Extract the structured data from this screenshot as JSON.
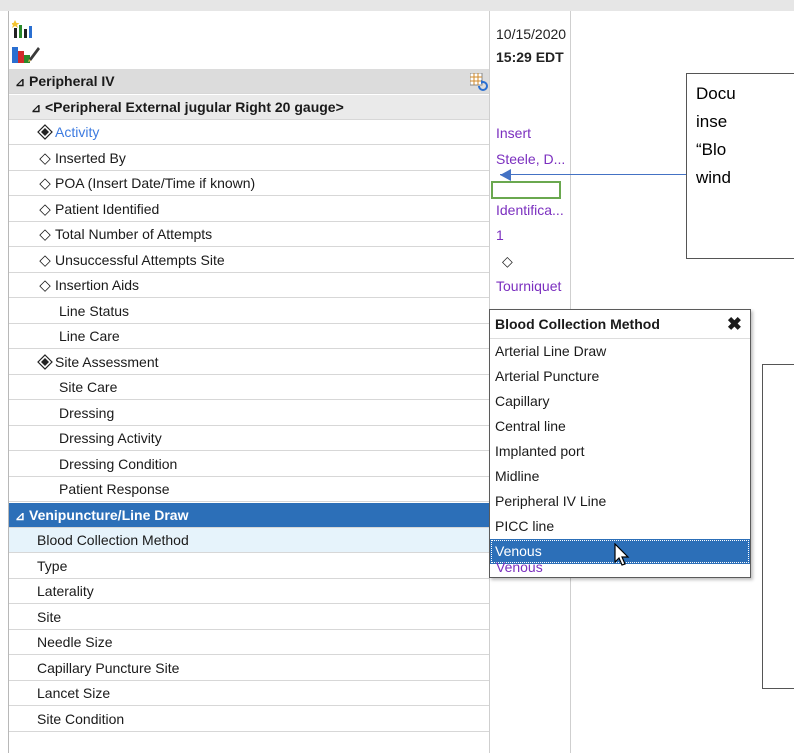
{
  "header": {
    "date": "10/15/2020",
    "time": "15:29 EDT"
  },
  "rows": [
    {
      "label": "Peripheral IV",
      "kind": "sect",
      "marker": "tri",
      "value": ""
    },
    {
      "label": "<Peripheral External jugular Right 20 gauge>",
      "kind": "sub",
      "marker": "tri",
      "value": ""
    },
    {
      "label": "Activity",
      "kind": "item",
      "marker": "dia-star",
      "blue": true,
      "value": "Insert"
    },
    {
      "label": "Inserted By",
      "kind": "item",
      "marker": "dia",
      "value": "Steele, D..."
    },
    {
      "label": "POA (Insert Date/Time if known)",
      "kind": "item",
      "marker": "dia",
      "value": ""
    },
    {
      "label": "Patient Identified",
      "kind": "item",
      "marker": "dia",
      "value": "Identifica..."
    },
    {
      "label": "Total Number of Attempts",
      "kind": "item",
      "marker": "dia",
      "value": "1"
    },
    {
      "label": "Unsuccessful Attempts Site",
      "kind": "item",
      "marker": "dia",
      "value": "◇"
    },
    {
      "label": "Insertion Aids",
      "kind": "item",
      "marker": "dia",
      "value": "Tourniquet"
    },
    {
      "label": "Line Status",
      "kind": "item",
      "marker": "none",
      "value": ""
    },
    {
      "label": "Line Care",
      "kind": "item",
      "marker": "none",
      "value": ""
    },
    {
      "label": "Site Assessment",
      "kind": "item",
      "marker": "dia-star",
      "value": ""
    },
    {
      "label": "Site Care",
      "kind": "item",
      "marker": "none",
      "value": ""
    },
    {
      "label": "Dressing",
      "kind": "item",
      "marker": "none",
      "value": ""
    },
    {
      "label": "Dressing Activity",
      "kind": "item",
      "marker": "none",
      "value": ""
    },
    {
      "label": "Dressing Condition",
      "kind": "item",
      "marker": "none",
      "value": ""
    },
    {
      "label": "Patient Response",
      "kind": "item",
      "marker": "none",
      "value": ""
    },
    {
      "label": "Venipuncture/Line Draw",
      "kind": "sel",
      "marker": "tri",
      "value": ""
    },
    {
      "label": "Blood Collection Method",
      "kind": "hl",
      "marker": "flat",
      "value": ""
    },
    {
      "label": "Type",
      "kind": "item",
      "marker": "flat",
      "value": "Venous"
    },
    {
      "label": "Laterality",
      "kind": "item",
      "marker": "flat",
      "value": ""
    },
    {
      "label": "Site",
      "kind": "item",
      "marker": "flat",
      "value": ""
    },
    {
      "label": "Needle Size",
      "kind": "item",
      "marker": "flat",
      "value": ""
    },
    {
      "label": "Capillary Puncture Site",
      "kind": "item",
      "marker": "flat",
      "value": ""
    },
    {
      "label": "Lancet Size",
      "kind": "item",
      "marker": "flat",
      "value": ""
    },
    {
      "label": "Site Condition",
      "kind": "item",
      "marker": "flat",
      "value": ""
    }
  ],
  "dropdown": {
    "title": "Blood Collection Method",
    "options": [
      "Arterial Line Draw",
      "Arterial Puncture",
      "Capillary",
      "Central line",
      "Implanted port",
      "Midline",
      "Peripheral IV Line",
      "PICC line",
      "Venous"
    ],
    "selected_index": 8
  },
  "callout": {
    "lines": [
      "Docu",
      "inse",
      "“Blo",
      "wind"
    ]
  },
  "colors": {
    "value_purple": "#7b2fbf",
    "selection_blue": "#2c6fb8",
    "activity_blue": "#3d7be0",
    "arrow_blue": "#4472c4",
    "green_box": "#6aa84f"
  }
}
